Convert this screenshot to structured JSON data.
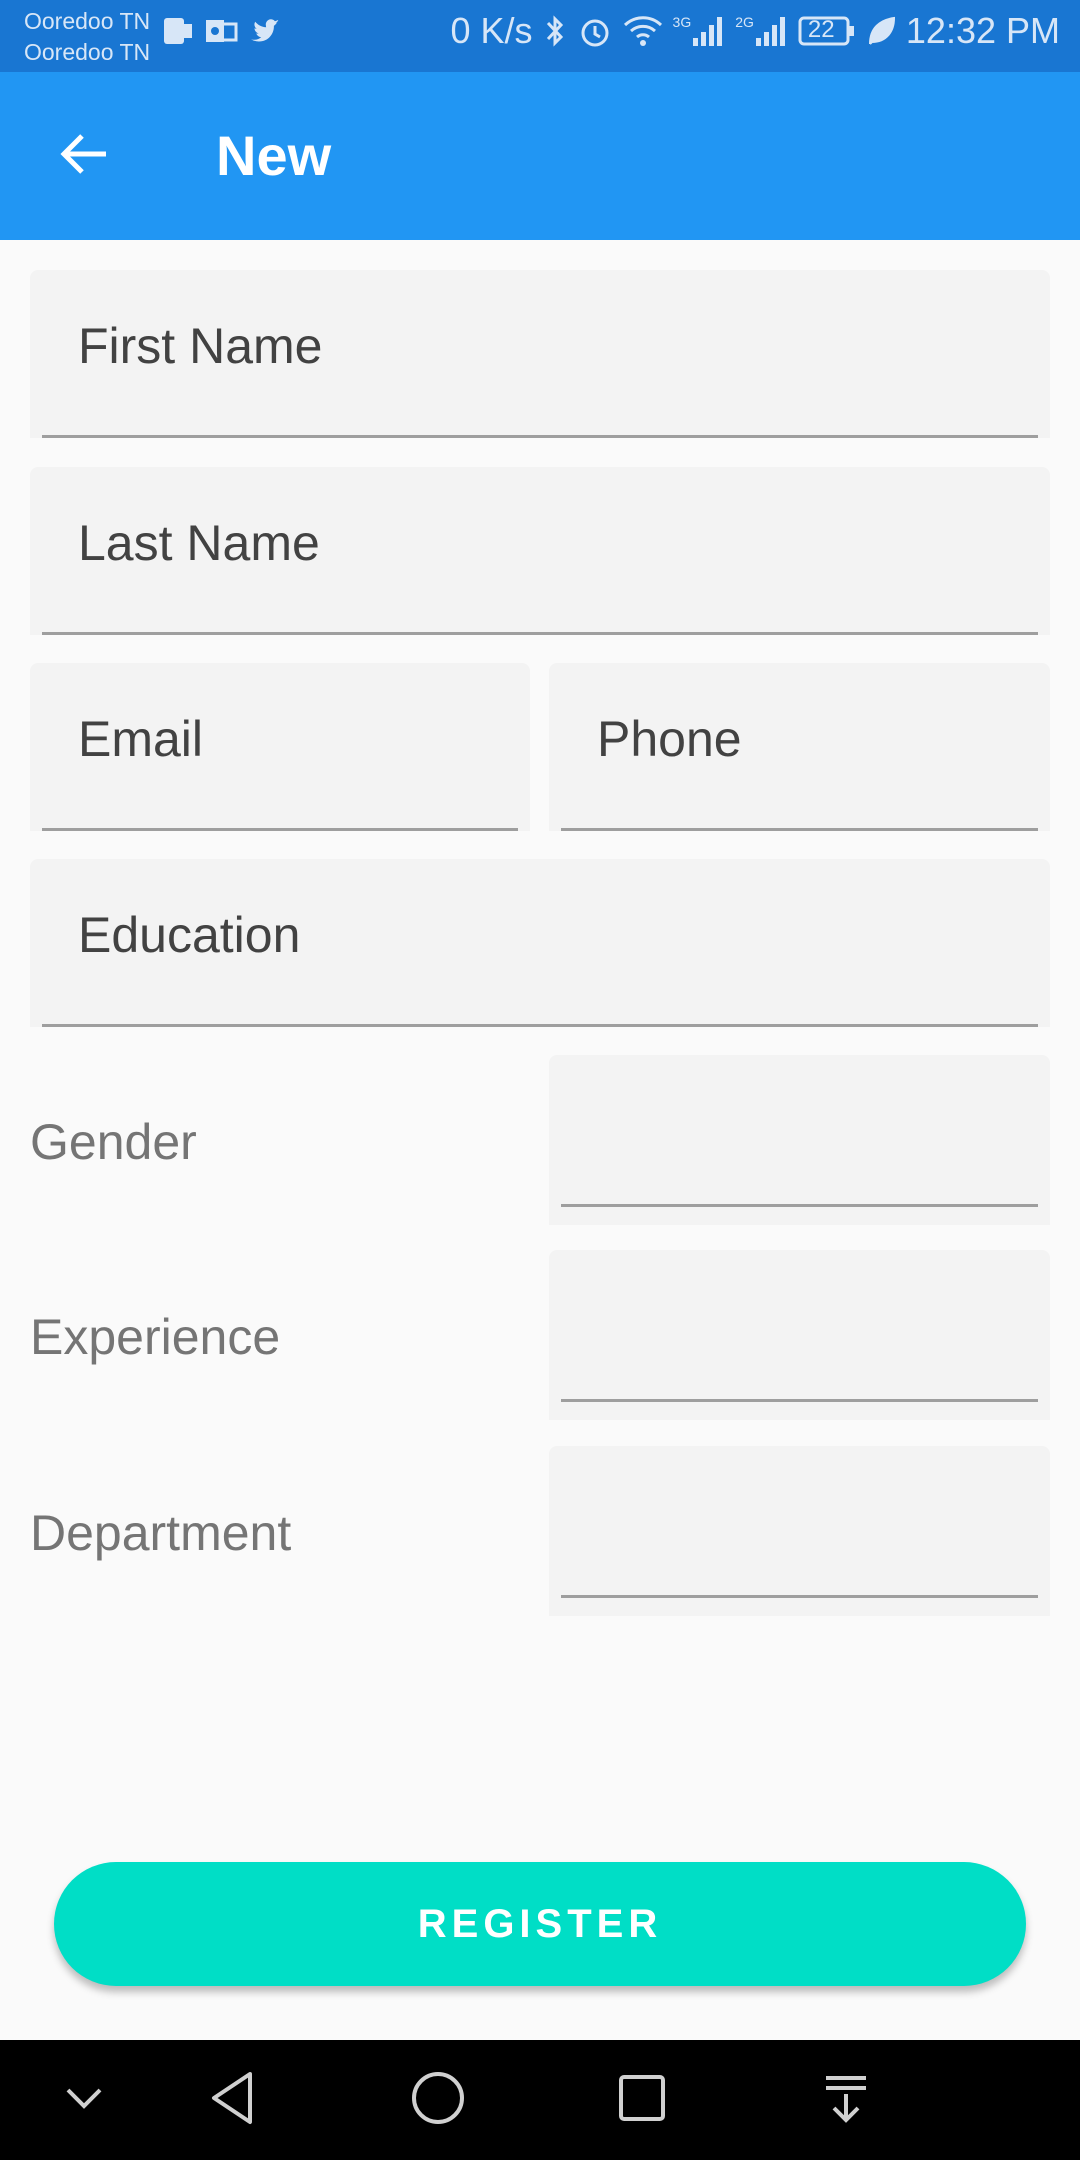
{
  "status_bar": {
    "carrier_1": "Ooredoo TN",
    "carrier_2": "Ooredoo TN",
    "net_speed": "0 K/s",
    "network_1": "3G",
    "network_2": "2G",
    "battery": "22",
    "time": "12:32 PM",
    "icons": [
      "sim-card-icon",
      "outlook-icon",
      "twitter-icon",
      "bluetooth-icon",
      "alarm-icon",
      "wifi-icon",
      "signal-icon",
      "battery-icon",
      "leaf-icon"
    ]
  },
  "app_bar": {
    "title": "New",
    "back_icon": "arrow-left-icon"
  },
  "form": {
    "first_name": {
      "placeholder": "First Name"
    },
    "last_name": {
      "placeholder": "Last Name"
    },
    "email": {
      "placeholder": "Email"
    },
    "phone": {
      "placeholder": "Phone"
    },
    "education": {
      "placeholder": "Education"
    },
    "gender": {
      "label": "Gender",
      "value": ""
    },
    "experience": {
      "label": "Experience",
      "value": ""
    },
    "department": {
      "label": "Department",
      "value": ""
    }
  },
  "register_button": {
    "label": "REGISTER"
  },
  "colors": {
    "app_bar": "#2196f3",
    "status_bar": "#1976d2",
    "accent": "#00dec6",
    "field_background": "#f3f3f3"
  },
  "nav_bar": {
    "icons": [
      "chevron-down-icon",
      "back-triangle-icon",
      "home-circle-icon",
      "recents-square-icon",
      "notification-pull-icon"
    ]
  }
}
